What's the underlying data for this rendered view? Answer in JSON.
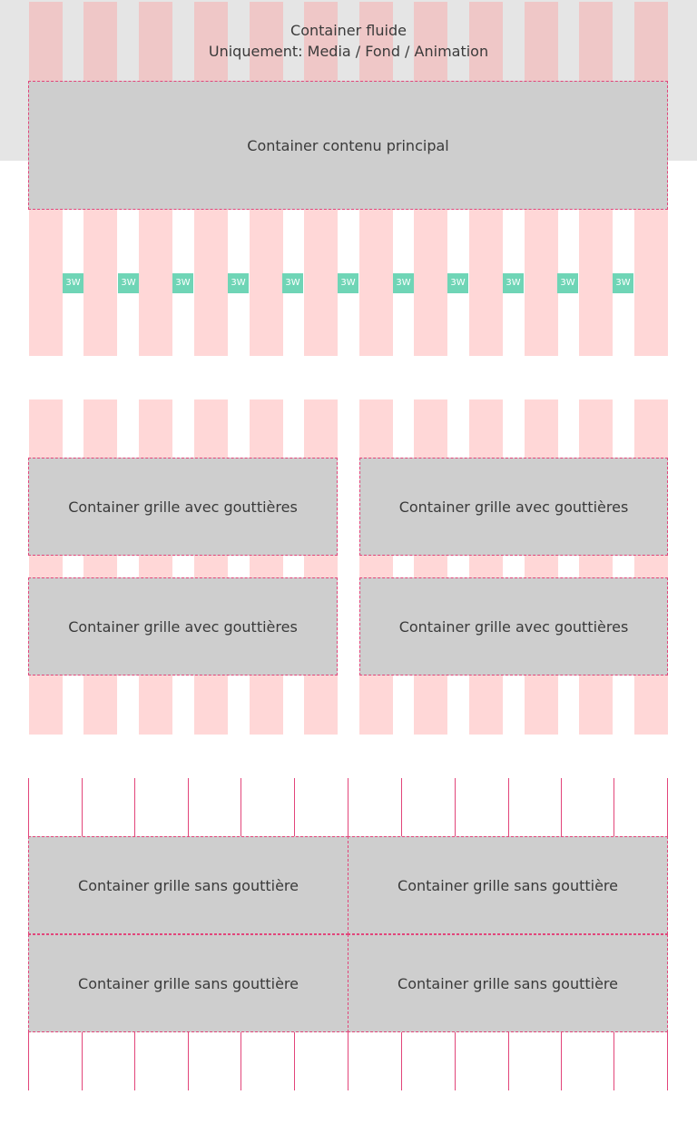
{
  "fluid": {
    "title": "Container fluide",
    "subtitle": "Uniquement: Media / Fond / Animation"
  },
  "main_container": {
    "label": "Container contenu principal"
  },
  "gutter_label": "3W",
  "grid_with_gutters": {
    "labels": [
      "Container grille avec gouttières",
      "Container grille avec gouttières",
      "Container grille avec gouttières",
      "Container grille avec gouttières"
    ]
  },
  "grid_without_gutters": {
    "labels": [
      "Container grille sans gouttière",
      "Container grille sans gouttière",
      "Container grille sans gouttière",
      "Container grille sans gouttière"
    ]
  },
  "colors": {
    "fluid_background": "#e5e5e5",
    "column": "#fdd5d5",
    "container": "#cecece",
    "guide_line": "#e2457a",
    "gutter_badge": "#6fd5b6"
  }
}
